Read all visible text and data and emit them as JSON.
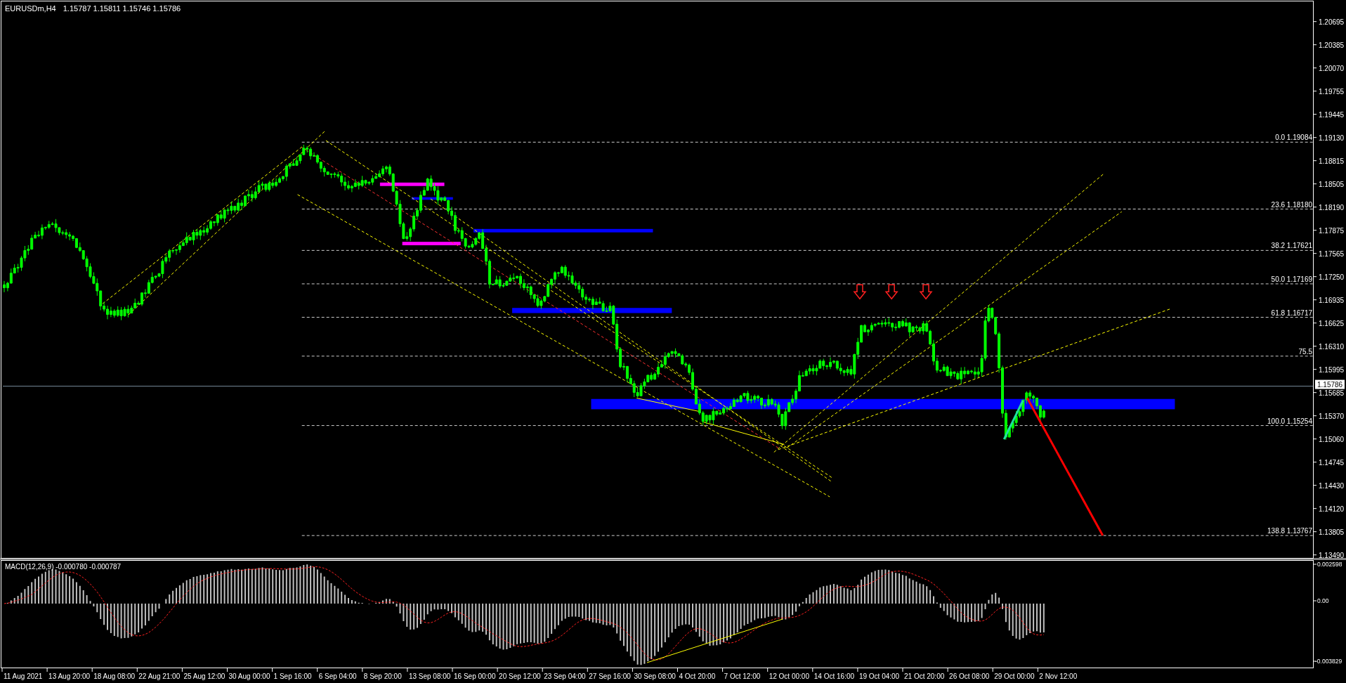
{
  "chart": {
    "symbol": "EURUSDm,H4",
    "ohlc": "1.15787 1.15811 1.15746 1.15786",
    "price_ticks": [
      "1.20695",
      "1.20385",
      "1.20070",
      "1.19755",
      "1.19445",
      "1.19130",
      "1.18815",
      "1.18505",
      "1.18190",
      "1.17875",
      "1.17565",
      "1.17250",
      "1.16935",
      "1.16625",
      "1.16310",
      "1.15995",
      "1.15685",
      "1.15370",
      "1.15060",
      "1.14745",
      "1.14430",
      "1.14120",
      "1.13805",
      "1.13490"
    ],
    "current_price": "1.15786",
    "fib_levels": [
      "0.0 1.19084",
      "23.6 1.18180",
      "38.2 1.17621",
      "50.0 1.17169",
      "61.8 1.16717",
      "75.5",
      "100.0 1.15254",
      "138.8 1.13767"
    ]
  },
  "macd": {
    "label": "MACD(12,26,9) -0.000780 -0.000787",
    "ticks": [
      "0.002598",
      "0.00",
      "-0.003829"
    ]
  },
  "time_axis": [
    "11 Aug 2021",
    "13 Aug 20:00",
    "18 Aug 08:00",
    "22 Aug 21:00",
    "25 Aug 12:00",
    "30 Aug 00:00",
    "1 Sep 16:00",
    "6 Sep 04:00",
    "8 Sep 20:00",
    "13 Sep 08:00",
    "16 Sep 00:00",
    "20 Sep 12:00",
    "23 Sep 04:00",
    "27 Sep 16:00",
    "30 Sep 08:00",
    "4 Oct 20:00",
    "7 Oct 12:00",
    "12 Oct 00:00",
    "14 Oct 16:00",
    "19 Oct 04:00",
    "21 Oct 20:00",
    "26 Oct 08:00",
    "29 Oct 00:00",
    "2 Nov 12:00"
  ]
}
